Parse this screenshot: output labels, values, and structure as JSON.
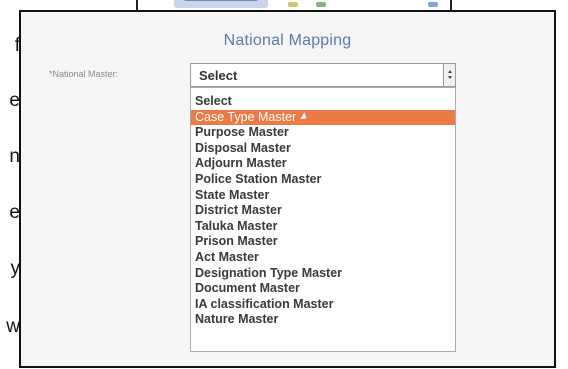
{
  "page_fragment": {
    "letters": [
      "f",
      "e",
      "n",
      "e",
      "y",
      "w"
    ]
  },
  "title": "National Mapping",
  "field": {
    "label": "*National Master:",
    "selected_value": "Select",
    "options": [
      "Select",
      "Case Type Master",
      "Purpose Master",
      "Disposal Master",
      "Adjourn Master",
      "Police Station Master",
      "State Master",
      "District Master",
      "Taluka Master",
      "Prison Master",
      "Act Master",
      "Designation Type Master",
      "Document Master",
      "IA classification Master",
      "Nature Master"
    ],
    "highlighted_index": 1
  },
  "colors": {
    "title": "#5b7aa6",
    "highlight": "#ee7a43"
  },
  "icons": {
    "pointer": "mouse-pointer-icon"
  }
}
